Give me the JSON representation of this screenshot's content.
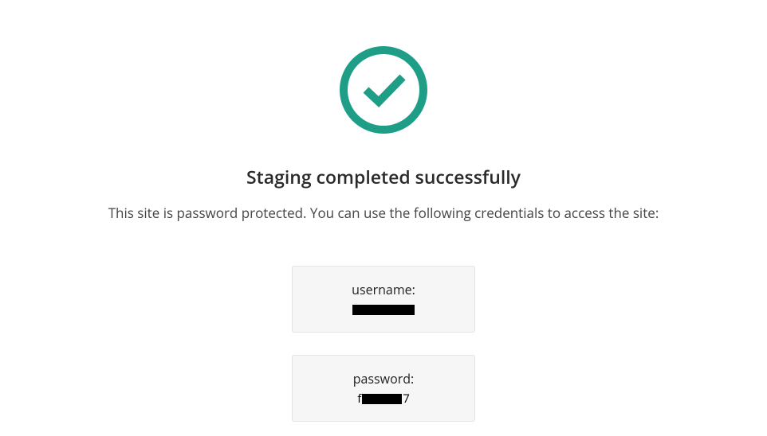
{
  "heading": "Staging completed successfully",
  "description": "This site is password protected. You can use the following credentials to access the site:",
  "credentials": {
    "username_label": "username:",
    "username_value": "",
    "password_label": "password:",
    "password_prefix": "f",
    "password_suffix": "7"
  },
  "colors": {
    "accent": "#1f9e87",
    "box_bg": "#f6f6f6",
    "box_border": "#e3e3e3"
  }
}
